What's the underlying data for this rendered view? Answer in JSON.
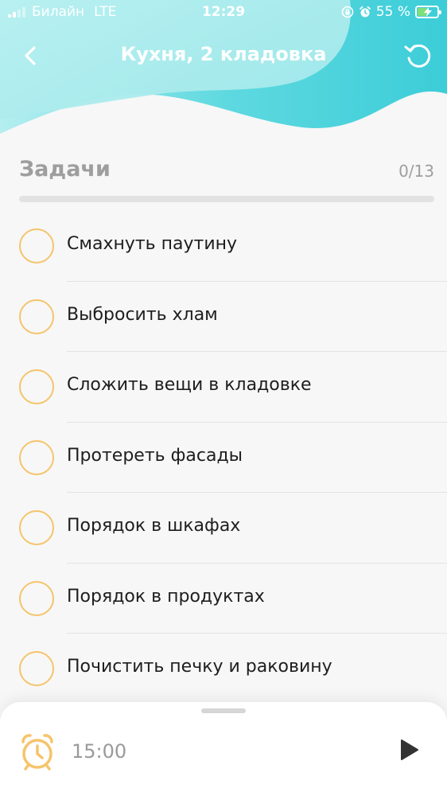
{
  "status_bar": {
    "carrier": "Билайн",
    "network": "LTE",
    "time": "12:29",
    "battery": "55 %",
    "battery_level": 0.55
  },
  "nav": {
    "title": "Кухня, 2 кладовка",
    "back_icon": "chevron-left-icon",
    "refresh_icon": "refresh-icon"
  },
  "tasks_section": {
    "title": "Задачи",
    "count": "0/13",
    "progress": 0
  },
  "tasks": [
    {
      "label": "Смахнуть паутину",
      "done": false
    },
    {
      "label": "Выбросить хлам",
      "done": false
    },
    {
      "label": "Сложить вещи в кладовке",
      "done": false
    },
    {
      "label": "Протереть фасады",
      "done": false
    },
    {
      "label": "Порядок в шкафах",
      "done": false
    },
    {
      "label": "Порядок в продуктах",
      "done": false
    },
    {
      "label": "Почистить печку и раковину",
      "done": false
    }
  ],
  "timer": {
    "value": "15:00",
    "icon": "alarm-clock-icon",
    "play_icon": "play-icon"
  },
  "colors": {
    "accent": "#f5c46b",
    "header_teal": "#3ccdd8",
    "header_light": "#a8ecee",
    "background": "#f7f7f7"
  }
}
